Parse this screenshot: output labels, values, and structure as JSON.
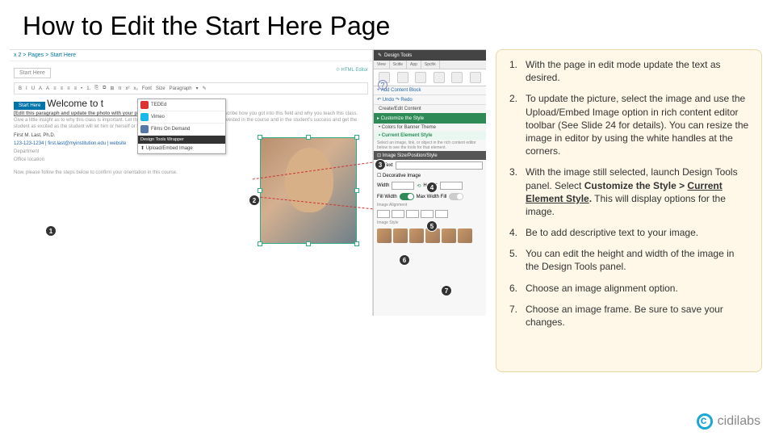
{
  "title": "How to Edit the Start Here Page",
  "steps": [
    "With the page in edit mode update the text as desired.",
    "To update the picture, select the image and use the Upload/Embed Image option in rich content editor toolbar (See Slide 24 for details). You can resize the image in editor by using the white handles at the corners.",
    "With the image still selected, launch Design Tools panel. Select <b>Customize the Style > <span class='underline'>Current Element Style</span>.</b> This will display options for the image.",
    "Be to add descriptive text to your image.",
    "You can edit the height and width of the image in the Design Tools panel.",
    "Choose an image alignment option.",
    "Choose an image frame. Be sure to save your changes."
  ],
  "footer_brand": "cidilabs",
  "screenshot": {
    "breadcrumb": "x 2 > Pages > Start Here",
    "page_label": "Start Here",
    "html_editor": "⟐ HTML Editor",
    "help_icon": "?",
    "toolbar_items": [
      "B",
      "I",
      "U",
      "A",
      "A",
      "≡",
      "≡",
      "≡",
      "≡",
      "•",
      "1.",
      "⎘",
      "⧉",
      "⊞",
      "π",
      "x²",
      "x₂",
      "Font",
      "Size",
      "Paragraph",
      "▾",
      "✎"
    ],
    "embed_popup": {
      "items": [
        "TEDEd",
        "Vimeo",
        "Films On Demand"
      ],
      "divider": "Design Tools Wrapper",
      "upload": "⬆ Upload/Embed Image"
    },
    "editor": {
      "tab": "Start Here",
      "welcome": "Welcome to t",
      "bold_line": "[Edit this paragraph and update the photo with your photo]",
      "body1": "Tell us a little bit about yourself, describe how you got into this field and why you teach this class. Give a little insight as to why this class is important. Let the student know you are a human being invested in the course and in the student's success and get the student as excited as the student will let him or herself or herself to be.",
      "sig_name": "First M. Last, Ph.D.",
      "sig_contact": "123-123-1234 | first.last@myinstitution.edu | website",
      "sig_dept": "Department",
      "sig_office": "Office location",
      "footer_line": "Now, please follow the steps below to confirm your orientation in this course."
    },
    "design_tools": {
      "header": "Design Tools",
      "tabs": [
        "View",
        "Scitle",
        "App",
        "Spchk"
      ],
      "add_block": "+ Add Content Block",
      "undo_redo": "↶ Undo  ↷ Redo",
      "quick_content": "Create/Edit Content",
      "customize": "▸ Customize the Style",
      "sub1": "• Colors for Banner Theme",
      "sub_current": "• Current Element Style",
      "caption": "Select an image, link, or object in the rich content editor below to see the tools for that element.",
      "img_section": "⊡ Image Size/Position/Style",
      "alt_label": "Alt Text",
      "decor_label": "☐ Decorative Image",
      "width_label": "Width",
      "height_label": "Height",
      "fillw": "Fill Width",
      "maxw": "Max Width Fill",
      "align_label": "Image Alignment",
      "style_label": "Image Style"
    },
    "badges": [
      "1",
      "2",
      "3",
      "4",
      "5",
      "6",
      "7"
    ]
  }
}
